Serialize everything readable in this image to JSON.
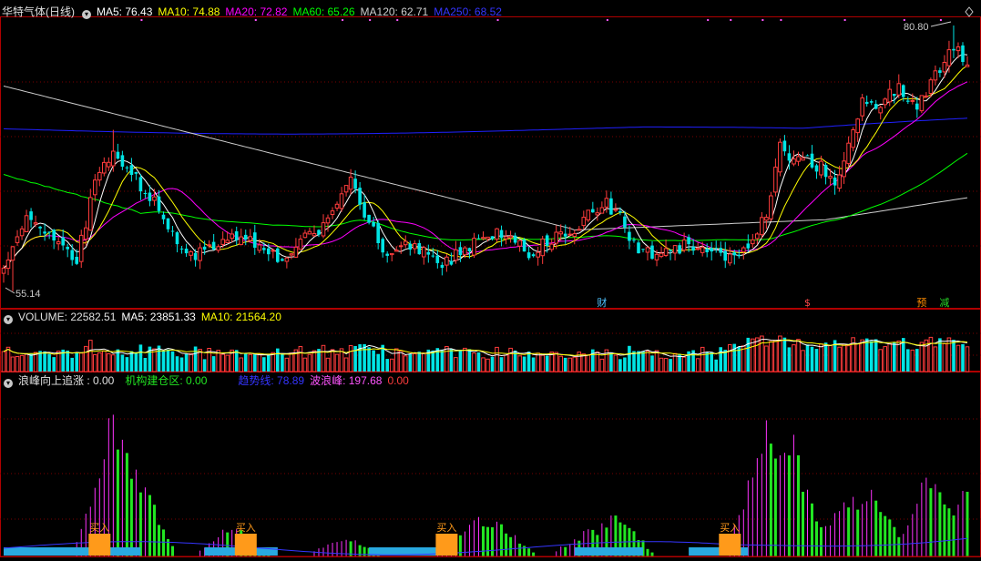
{
  "main_header": {
    "title": "华特气体(日线)",
    "ma5": "MA5: 76.43",
    "ma10": "MA10: 74.88",
    "ma20": "MA20: 72.82",
    "ma60": "MA60: 65.26",
    "ma120": "MA120: 62.71",
    "ma250": "MA250: 68.52"
  },
  "vol_header": {
    "volume": "VOLUME: 22582.51",
    "ma5": "MA5: 23851.33",
    "ma10": "MA10: 21564.20"
  },
  "ind_header": {
    "item1": "浪峰向上追涨 : 0.00",
    "item2": "机构建仓区: 0.00",
    "item3": "趋势线: 78.89",
    "item4": "波浪峰: 197.68",
    "item5": "0.00"
  },
  "price_labels": {
    "high": "80.80",
    "low": "55.14"
  },
  "event_markers": [
    {
      "text": "财",
      "color": "#4fc3ff",
      "index": 131
    },
    {
      "text": "$",
      "color": "#ff4a4a",
      "index": 176
    },
    {
      "text": "预",
      "color": "#ff8c00",
      "index": 201
    },
    {
      "text": "减",
      "color": "#28d628",
      "index": 206
    }
  ],
  "buy_label": "买入",
  "colors": {
    "up": "#ff3c3c",
    "down": "#00e4e4",
    "ma5": "#ffffff",
    "ma10": "#ffff00",
    "ma20": "#ff00ff",
    "ma60": "#00ff00",
    "ma120": "#d0d0d0",
    "ma250": "#2020ff",
    "grid": "#7a0000",
    "axis": "#b00000"
  },
  "chart_data": {
    "type": "candlestick",
    "period": "daily",
    "ylim": [
      55.14,
      80.8
    ],
    "anchors": [
      [
        0,
        57.5
      ],
      [
        5,
        62
      ],
      [
        10,
        60.5
      ],
      [
        16,
        58
      ],
      [
        20,
        66
      ],
      [
        24,
        69
      ],
      [
        28,
        66.5
      ],
      [
        33,
        64
      ],
      [
        36,
        61
      ],
      [
        41,
        58.5
      ],
      [
        46,
        60
      ],
      [
        52,
        61
      ],
      [
        56,
        59.5
      ],
      [
        61,
        58.2
      ],
      [
        66,
        60.5
      ],
      [
        71,
        62
      ],
      [
        76,
        66
      ],
      [
        80,
        62
      ],
      [
        84,
        59
      ],
      [
        88,
        60
      ],
      [
        92,
        59
      ],
      [
        96,
        58
      ],
      [
        100,
        59
      ],
      [
        104,
        60.5
      ],
      [
        108,
        61
      ],
      [
        111,
        60
      ],
      [
        115,
        59
      ],
      [
        119,
        60
      ],
      [
        123,
        61
      ],
      [
        127,
        62
      ],
      [
        131,
        64
      ],
      [
        134,
        63
      ],
      [
        138,
        60
      ],
      [
        142,
        58.5
      ],
      [
        146,
        59
      ],
      [
        150,
        60
      ],
      [
        154,
        59.3
      ],
      [
        158,
        58.5
      ],
      [
        163,
        59.5
      ],
      [
        167,
        63
      ],
      [
        170,
        69
      ],
      [
        174,
        68
      ],
      [
        178,
        67.5
      ],
      [
        182,
        66
      ],
      [
        185,
        69
      ],
      [
        188,
        74
      ],
      [
        192,
        73
      ],
      [
        196,
        75
      ],
      [
        200,
        73
      ],
      [
        204,
        76
      ],
      [
        208,
        79
      ],
      [
        211,
        77.5
      ]
    ],
    "buy_signal_indices": [
      21,
      53,
      97,
      159
    ],
    "ind_ylim": [
      0,
      200
    ]
  }
}
